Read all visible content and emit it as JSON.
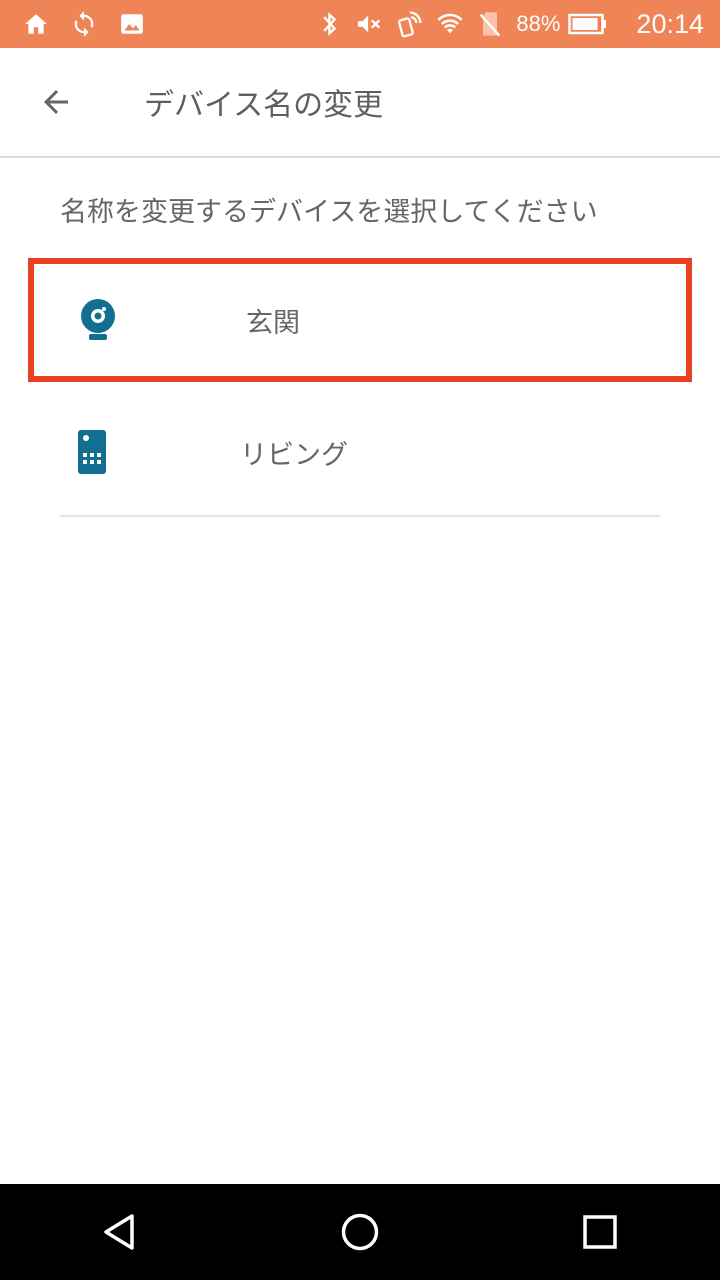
{
  "status_bar": {
    "battery_text": "88%",
    "time": "20:14",
    "left_icons": [
      "home-icon",
      "sync-icon",
      "image-icon"
    ],
    "right_icons": [
      "bluetooth-icon",
      "mute-icon",
      "nfc-icon",
      "wifi-icon",
      "no-sim-icon",
      "battery-icon"
    ],
    "background": "#ef8456"
  },
  "app_bar": {
    "title": "デバイス名の変更",
    "back_icon": "arrow-back-icon"
  },
  "instruction": "名称を変更するデバイスを選択してください",
  "devices": [
    {
      "label": "玄関",
      "icon": "camera-icon",
      "selected": true
    },
    {
      "label": "リビング",
      "icon": "remote-control-icon",
      "selected": false
    }
  ],
  "colors": {
    "accent_device": "#136f91",
    "selection_border": "#e9401f"
  },
  "nav_bar": {
    "buttons": [
      "back-triangle-icon",
      "home-circle-icon",
      "recents-square-icon"
    ]
  }
}
